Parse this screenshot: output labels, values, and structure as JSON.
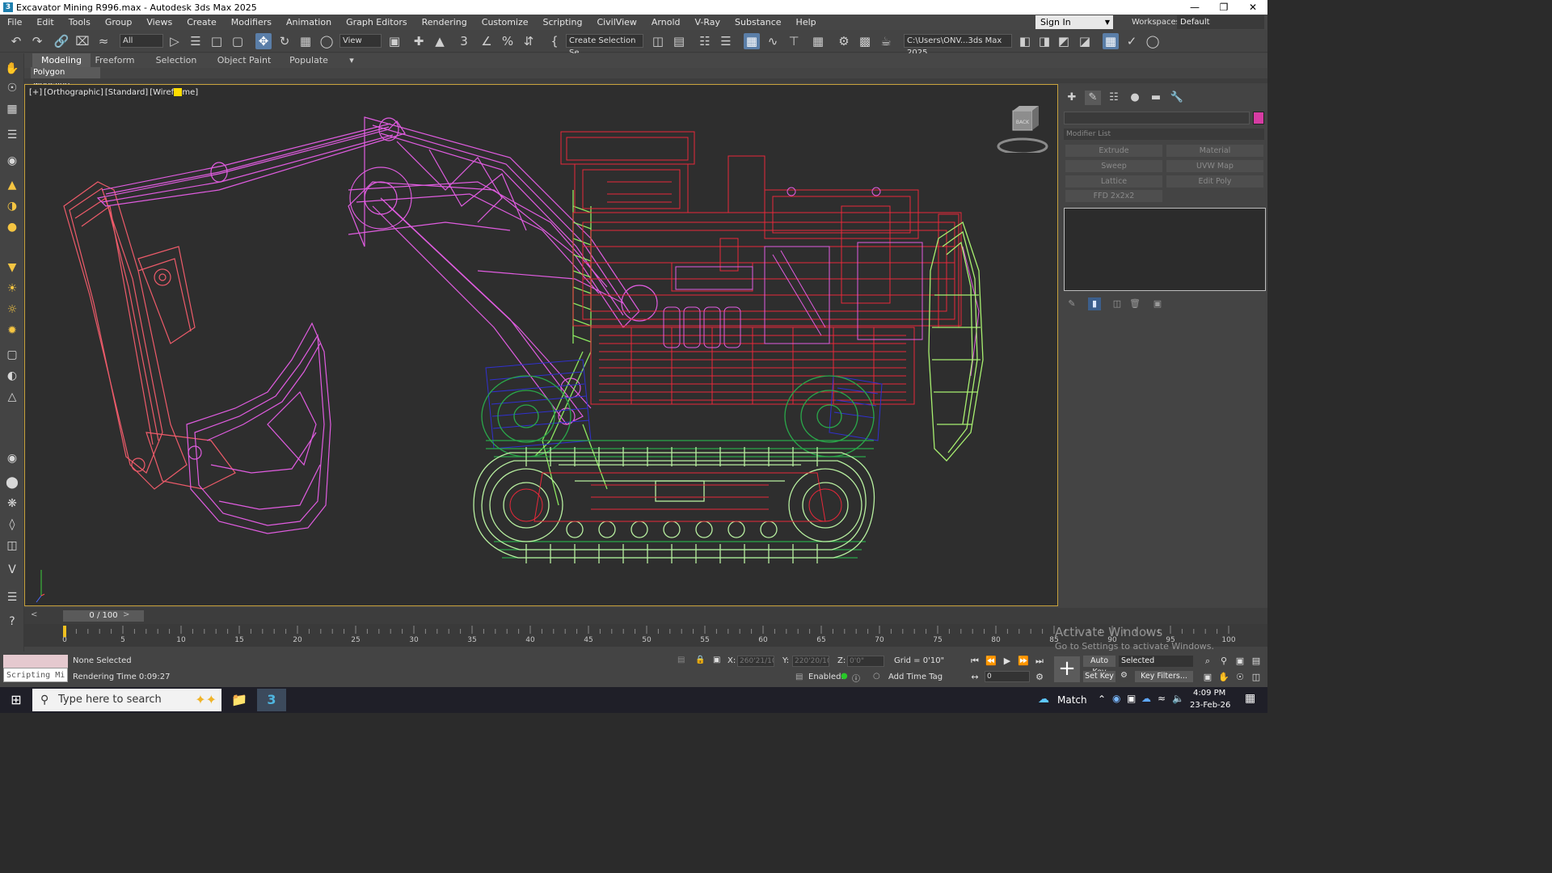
{
  "window": {
    "title": "Excavator Mining R996.max - Autodesk 3ds Max 2025",
    "app_icon": "3ds-max-icon",
    "controls": [
      "minimize-icon",
      "restore-icon",
      "close-icon"
    ]
  },
  "menu": {
    "items": [
      "File",
      "Edit",
      "Tools",
      "Group",
      "Views",
      "Create",
      "Modifiers",
      "Animation",
      "Graph Editors",
      "Rendering",
      "Customize",
      "Scripting",
      "CivilView",
      "Arnold",
      "V-Ray",
      "Substance",
      "Help"
    ],
    "sign_in": "Sign In",
    "workspaces_label": "Workspaces:",
    "workspace_value": "Default"
  },
  "toolbar": {
    "filter_value": "All",
    "ref_coord_value": "View",
    "selection_set_value": "Create Selection Se",
    "project_path": "C:\\Users\\ONV...3ds Max 2025"
  },
  "ribbon": {
    "tabs": [
      "Modeling",
      "Freeform",
      "Selection",
      "Object Paint",
      "Populate"
    ],
    "active_tab": "Modeling",
    "sub_panel": "Polygon Modeling"
  },
  "viewport": {
    "label_parts": [
      "[+]",
      "[Orthographic]",
      "[Standard]",
      "[Wireframe]"
    ],
    "viewcube_label": "BACK",
    "colors": {
      "boom": "#e05ce0",
      "stick": "#ee5b6a",
      "cab": "#e8283a",
      "tracks": "#b8f0a0",
      "rollers": "#2aa84a",
      "ladder": "#8ce860",
      "blue": "#3030d0",
      "counterweight": "#a8f070"
    }
  },
  "command_panel": {
    "modifier_list": "Modifier List",
    "buttons": [
      "Extrude",
      "Material",
      "Sweep",
      "UVW Map",
      "Lattice",
      "Edit Poly",
      "FFD 2x2x2"
    ],
    "object_color": "#d63ca3"
  },
  "timeline": {
    "frame_display": "0 / 100",
    "ticks": [
      "0",
      "5",
      "10",
      "15",
      "20",
      "25",
      "30",
      "35",
      "40",
      "45",
      "50",
      "55",
      "60",
      "65",
      "70",
      "75",
      "80",
      "85",
      "90",
      "95",
      "100"
    ]
  },
  "status": {
    "script_placeholder": "Scripting Mi",
    "selection": "None Selected",
    "rendering_time": "Rendering Time  0:09:27",
    "x_label": "X:",
    "x_value": "260'21/10",
    "y_label": "Y:",
    "y_value": "220'20/10",
    "z_label": "Z:",
    "z_value": "0'0\"",
    "grid": "Grid = 0'10\"",
    "enabled_label": "Enabled:",
    "add_time_tag": "Add Time Tag",
    "auto_key": "Auto Key",
    "set_key": "Set Key",
    "key_mode": "Selected",
    "key_filters": "Key Filters...",
    "current_frame": "0"
  },
  "watermark": {
    "line1": "Activate Windows",
    "line2": "Go to Settings to activate Windows."
  },
  "taskbar": {
    "search_placeholder": "Type here to search",
    "weather": "Match",
    "time": "4:09 PM",
    "date": "23-Feb-26"
  }
}
